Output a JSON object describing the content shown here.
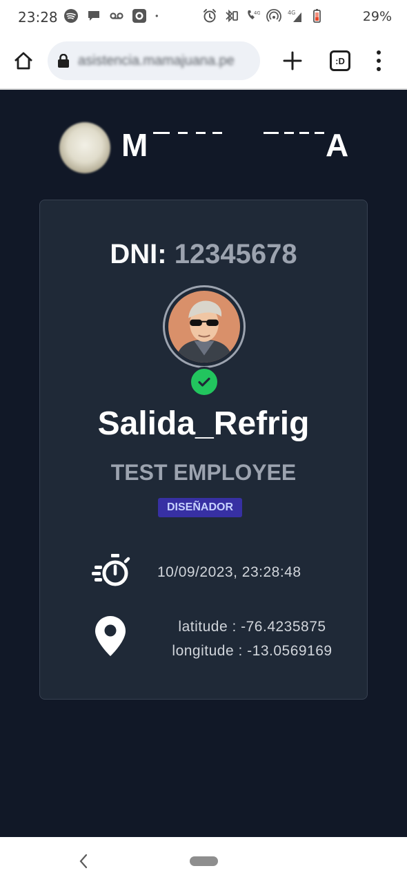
{
  "status_bar": {
    "time": "23:28",
    "network_4g_1": "4G",
    "network_4g_2": "4G",
    "battery": "29%"
  },
  "browser": {
    "url": "asistencia.mamajuana.pe",
    "tabs_label": ":D"
  },
  "header": {
    "brand_initial": "M",
    "brand_final": "A"
  },
  "card": {
    "dni_label": "DNI:",
    "dni_value": "12345678",
    "event": "Salida_Refrig",
    "employee": "TEST EMPLOYEE",
    "role": "DISEÑADOR",
    "timestamp": "10/09/2023, 23:28:48",
    "latitude": "latitude : -76.4235875",
    "longitude": "longitude : -13.0569169",
    "status_color": "#22c55e"
  }
}
